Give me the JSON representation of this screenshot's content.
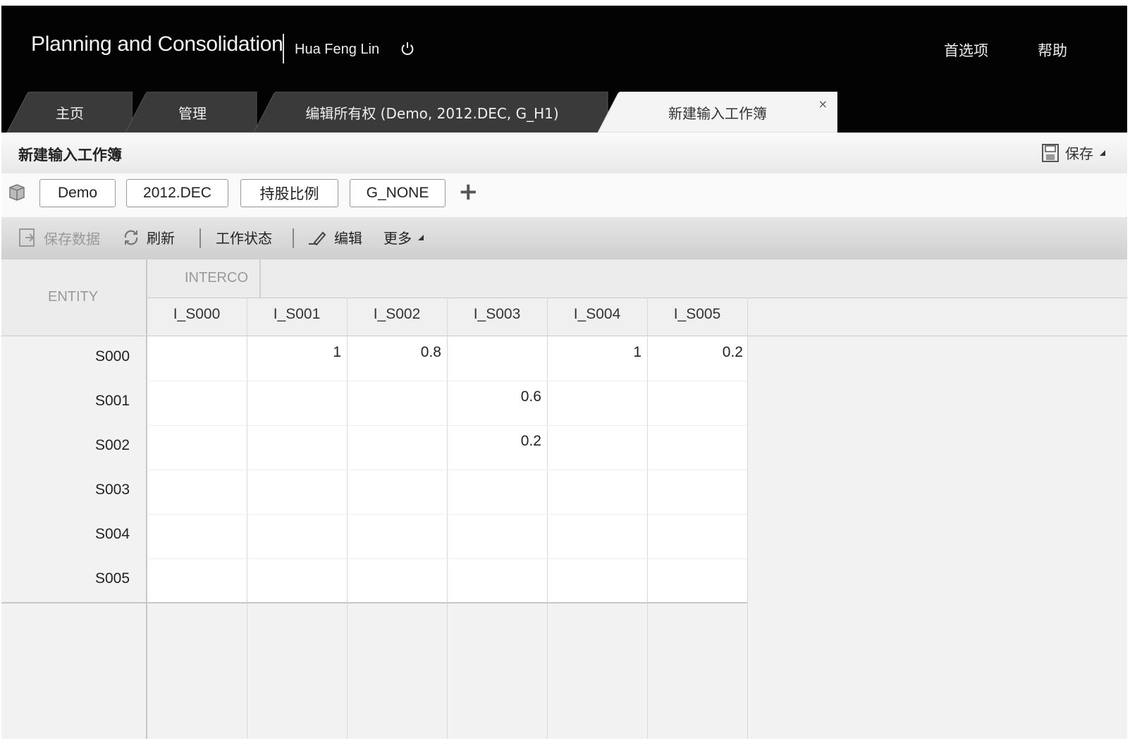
{
  "header": {
    "app_title": "Planning and Consolidation",
    "user": "Hua Feng Lin",
    "links": [
      "首选项",
      "帮助"
    ]
  },
  "tabs": [
    {
      "label": "主页",
      "active": false
    },
    {
      "label": "管理",
      "active": false
    },
    {
      "label": "编辑所有权 (Demo, 2012.DEC, G_H1)",
      "active": false
    },
    {
      "label": "新建输入工作簿",
      "active": true,
      "close": "×"
    }
  ],
  "page": {
    "title": "新建输入工作簿",
    "save_label": "保存"
  },
  "pov": [
    "Demo",
    "2012.DEC",
    "持股比例",
    "G_NONE"
  ],
  "pov_add": "+",
  "toolbar": {
    "save_data": "保存数据",
    "refresh": "刷新",
    "work_status": "工作状态",
    "edit": "编辑",
    "more": "更多"
  },
  "grid": {
    "row_dim": "ENTITY",
    "col_dim": "INTERCO",
    "columns": [
      "I_S000",
      "I_S001",
      "I_S002",
      "I_S003",
      "I_S004",
      "I_S005"
    ],
    "rows": [
      {
        "label": "S000",
        "values": [
          "",
          "1",
          "0.8",
          "",
          "1",
          "0.2"
        ]
      },
      {
        "label": "S001",
        "values": [
          "",
          "",
          "",
          "0.6",
          "",
          ""
        ]
      },
      {
        "label": "S002",
        "values": [
          "",
          "",
          "",
          "0.2",
          "",
          ""
        ]
      },
      {
        "label": "S003",
        "values": [
          "",
          "",
          "",
          "",
          "",
          ""
        ]
      },
      {
        "label": "S004",
        "values": [
          "",
          "",
          "",
          "",
          "",
          ""
        ]
      },
      {
        "label": "S005",
        "values": [
          "",
          "",
          "",
          "",
          "",
          ""
        ]
      }
    ]
  },
  "colors": {
    "topbar": "#030303",
    "toolbar": "#d6d6d6",
    "grid_bg": "#f2f2f2"
  }
}
